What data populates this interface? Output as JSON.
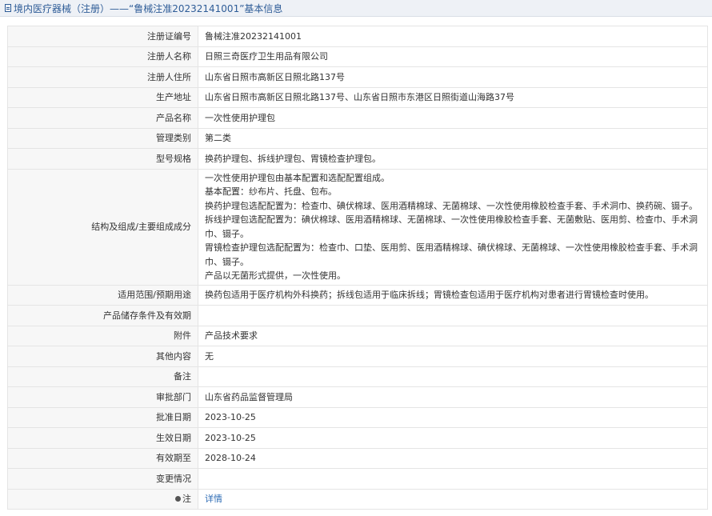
{
  "header": {
    "title": "境内医疗器械（注册）——“鲁械注准20232141001”基本信息"
  },
  "rows": [
    {
      "label": "注册证编号",
      "value": "鲁械注准20232141001"
    },
    {
      "label": "注册人名称",
      "value": "日照三奇医疗卫生用品有限公司"
    },
    {
      "label": "注册人住所",
      "value": "山东省日照市高新区日照北路137号"
    },
    {
      "label": "生产地址",
      "value": "山东省日照市高新区日照北路137号、山东省日照市东港区日照街道山海路37号"
    },
    {
      "label": "产品名称",
      "value": "一次性使用护理包"
    },
    {
      "label": "管理类别",
      "value": "第二类"
    },
    {
      "label": "型号规格",
      "value": "换药护理包、拆线护理包、胃镜检查护理包。"
    },
    {
      "label": "结构及组成/主要组成成分",
      "lines": [
        "一次性使用护理包由基本配置和选配配置组成。",
        "基本配置：纱布片、托盘、包布。",
        "换药护理包选配配置为：检查巾、碘伏棉球、医用酒精棉球、无菌棉球、一次性使用橡胶检查手套、手术洞巾、换药碗、镊子。",
        "拆线护理包选配配置为：碘伏棉球、医用酒精棉球、无菌棉球、一次性使用橡胶检查手套、无菌敷贴、医用剪、检查巾、手术洞巾、镊子。",
        "胃镜检查护理包选配配置为：检查巾、口垫、医用剪、医用酒精棉球、碘伏棉球、无菌棉球、一次性使用橡胶检查手套、手术洞巾、镊子。",
        "产品以无菌形式提供，一次性使用。"
      ]
    },
    {
      "label": "适用范围/预期用途",
      "value": "换药包适用于医疗机构外科换药；拆线包适用于临床拆线；胃镜检查包适用于医疗机构对患者进行胃镜检查时使用。"
    },
    {
      "label": "产品储存条件及有效期",
      "value": ""
    },
    {
      "label": "附件",
      "value": "产品技术要求"
    },
    {
      "label": "其他内容",
      "value": "无"
    },
    {
      "label": "备注",
      "value": ""
    },
    {
      "label": "审批部门",
      "value": "山东省药品监督管理局"
    },
    {
      "label": "批准日期",
      "value": "2023-10-25"
    },
    {
      "label": "生效日期",
      "value": "2023-10-25"
    },
    {
      "label": "有效期至",
      "value": "2028-10-24"
    },
    {
      "label": "变更情况",
      "value": ""
    },
    {
      "label": "注",
      "value": "详情",
      "icon": "pin-icon"
    }
  ],
  "colors": {
    "header_bg": "#eef1f6",
    "header_text": "#2e5c97",
    "label_bg": "#f7f7f7",
    "border": "#e4e4e4",
    "link": "#2e6cb5"
  }
}
